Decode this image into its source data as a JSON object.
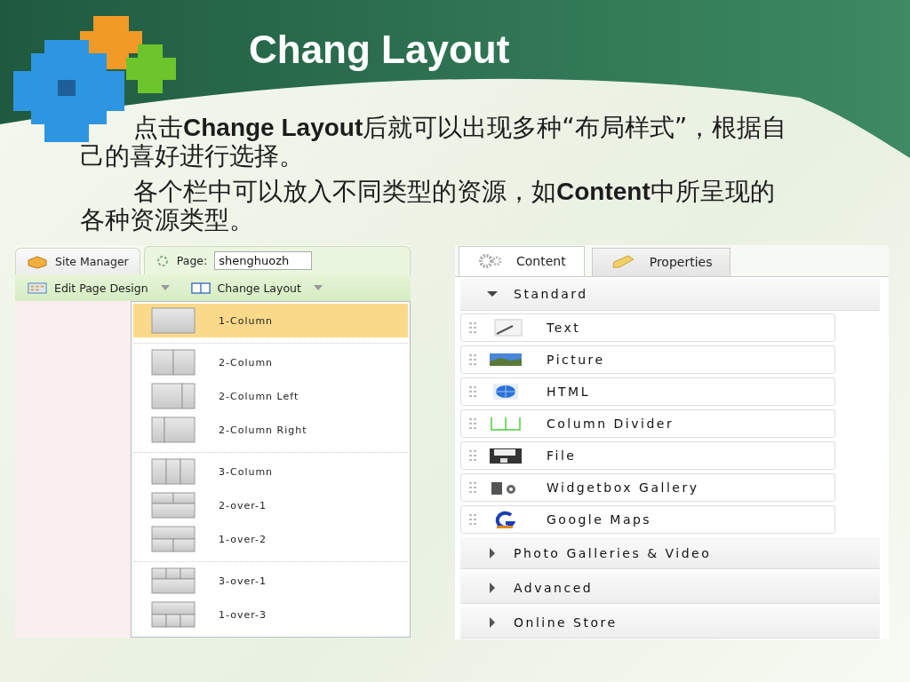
{
  "slide": {
    "title": "Chang Layout",
    "paragraphs": [
      "点击**Change Layout**后就可以出现多种“布局样式”，根据自己的喜好进行选择。",
      "各个栏中可以放入不同类型的资源，如**Content**中所呈现的各种资源类型。"
    ]
  },
  "site_manager": {
    "tabs": [
      {
        "label": "Site Manager",
        "kind": "box",
        "selected": false
      },
      {
        "label": "Page:",
        "kind": "spinner",
        "selected": true
      }
    ],
    "page_field": {
      "value": "shenghuozh"
    },
    "toolbar": [
      {
        "label": "Edit Page Design",
        "kind": "grid"
      },
      {
        "label": "Change Layout",
        "kind": "columns"
      }
    ],
    "layout_menu": [
      [
        {
          "label": "1-Column",
          "kind": "single",
          "selected": true
        }
      ],
      [
        {
          "label": "2-Column",
          "kind": "halves",
          "selected": false
        },
        {
          "label": "2-Column Left",
          "kind": "wideleft",
          "selected": false
        },
        {
          "label": "2-Column Right",
          "kind": "wideright",
          "selected": false
        }
      ],
      [
        {
          "label": "3-Column",
          "kind": "thirds",
          "selected": false
        },
        {
          "label": "2-over-1",
          "kind": "twoone",
          "selected": false
        },
        {
          "label": "1-over-2",
          "kind": "onetwo",
          "selected": false
        }
      ],
      [
        {
          "label": "3-over-1",
          "kind": "threeone",
          "selected": false
        },
        {
          "label": "1-over-3",
          "kind": "onethree",
          "selected": false
        }
      ]
    ]
  },
  "content_panel": {
    "tabs": [
      {
        "label": "Content",
        "kind": "gear",
        "selected": true
      },
      {
        "label": "Properties",
        "kind": "pencil",
        "selected": false
      }
    ],
    "categories": [
      {
        "label": "Standard",
        "expanded": true,
        "items": [
          {
            "label": "Text",
            "kind": "text"
          },
          {
            "label": "Picture",
            "kind": "picture"
          },
          {
            "label": "HTML",
            "kind": "html"
          },
          {
            "label": "Column Divider",
            "kind": "divider"
          },
          {
            "label": "File",
            "kind": "file"
          },
          {
            "label": "Widgetbox Gallery",
            "kind": "widget"
          },
          {
            "label": "Google Maps",
            "kind": "maps"
          }
        ]
      },
      {
        "label": "Photo Galleries & Video",
        "expanded": false
      },
      {
        "label": "Advanced",
        "expanded": false
      },
      {
        "label": "Online Store",
        "expanded": false
      }
    ]
  }
}
